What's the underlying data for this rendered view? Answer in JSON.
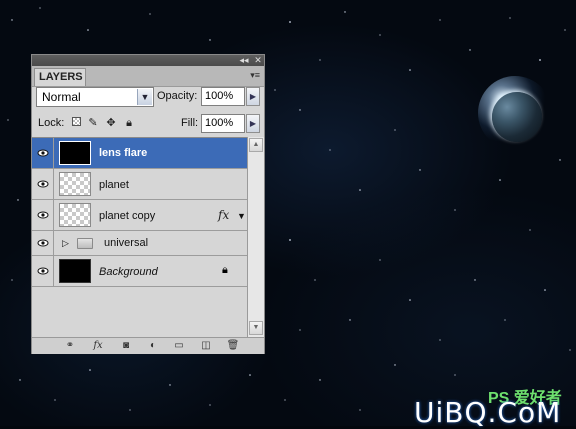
{
  "panel": {
    "tab_label": "LAYERS",
    "blend_mode": "Normal",
    "opacity_label": "Opacity:",
    "opacity_value": "100%",
    "lock_label": "Lock:",
    "fill_label": "Fill:",
    "fill_value": "100%"
  },
  "layers": [
    {
      "name": "lens flare",
      "selected": true,
      "thumb": "black",
      "visible": true
    },
    {
      "name": "planet",
      "selected": false,
      "thumb": "transparent",
      "visible": true
    },
    {
      "name": "planet  copy",
      "selected": false,
      "thumb": "transparent",
      "visible": true,
      "has_effects": true,
      "fx_label": "fx"
    },
    {
      "name": "universal",
      "type": "group",
      "collapsed": true,
      "visible": true
    },
    {
      "name": "Background",
      "selected": false,
      "thumb": "black",
      "visible": true,
      "locked": true,
      "italic": true
    }
  ],
  "bottom_icons": [
    "link-icon",
    "fx-icon",
    "mask-icon",
    "adjustment-icon",
    "folder-icon",
    "new-layer-icon",
    "trash-icon"
  ],
  "bottom_fx_label": "fx",
  "watermark": {
    "top": "PS 爱好者",
    "main": "UiBQ.CoM"
  },
  "colors": {
    "selected_row": "#3c6bb7",
    "panel_bg": "#d6d6d6",
    "space_bg": "#040911"
  }
}
